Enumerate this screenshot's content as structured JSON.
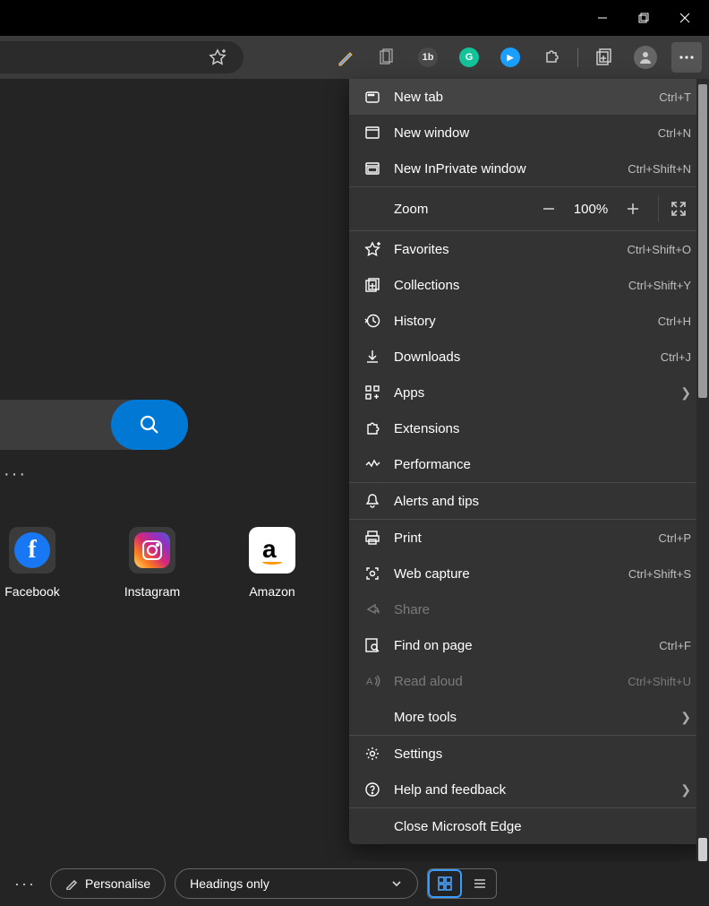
{
  "window": {
    "minimize": "Minimize",
    "restore": "Restore",
    "close": "Close"
  },
  "toolbar": {
    "favorite": "Add to favorites"
  },
  "tiles": [
    {
      "label": "Facebook",
      "bg": "#3b3b3b",
      "glyph_bg": "#1877f2",
      "glyph": "f",
      "glyph_color": "#fff"
    },
    {
      "label": "Instagram",
      "bg": "#3b3b3b",
      "glyph_bg": "linear-gradient(45deg,#feda75,#d62976,#4f5bd5)",
      "glyph": "ig",
      "glyph_color": "#fff"
    },
    {
      "label": "Amazon",
      "bg": "#ffffff",
      "glyph_bg": "#ffffff",
      "glyph": "a",
      "glyph_color": "#000"
    }
  ],
  "menu": {
    "zoom_label": "Zoom",
    "zoom_value": "100%",
    "items": [
      {
        "label": "New tab",
        "shortcut": "Ctrl+T",
        "icon": "newtab",
        "highlight": true
      },
      {
        "label": "New window",
        "shortcut": "Ctrl+N",
        "icon": "window"
      },
      {
        "label": "New InPrivate window",
        "shortcut": "Ctrl+Shift+N",
        "icon": "inprivate"
      },
      {
        "sep": true
      },
      {
        "zoom": true
      },
      {
        "sep": true
      },
      {
        "label": "Favorites",
        "shortcut": "Ctrl+Shift+O",
        "icon": "favorites"
      },
      {
        "label": "Collections",
        "shortcut": "Ctrl+Shift+Y",
        "icon": "collections"
      },
      {
        "label": "History",
        "shortcut": "Ctrl+H",
        "icon": "history"
      },
      {
        "label": "Downloads",
        "shortcut": "Ctrl+J",
        "icon": "downloads"
      },
      {
        "label": "Apps",
        "chevron": true,
        "icon": "apps"
      },
      {
        "label": "Extensions",
        "icon": "extensions"
      },
      {
        "label": "Performance",
        "icon": "performance"
      },
      {
        "sep": true
      },
      {
        "label": "Alerts and tips",
        "icon": "bell"
      },
      {
        "sep": true
      },
      {
        "label": "Print",
        "shortcut": "Ctrl+P",
        "icon": "print"
      },
      {
        "label": "Web capture",
        "shortcut": "Ctrl+Shift+S",
        "icon": "capture"
      },
      {
        "label": "Share",
        "icon": "share",
        "disabled": true
      },
      {
        "label": "Find on page",
        "shortcut": "Ctrl+F",
        "icon": "find"
      },
      {
        "label": "Read aloud",
        "shortcut": "Ctrl+Shift+U",
        "icon": "readaloud",
        "disabled": true
      },
      {
        "label": "More tools",
        "chevron": true,
        "icon": "blank"
      },
      {
        "sep": true
      },
      {
        "label": "Settings",
        "icon": "settings"
      },
      {
        "label": "Help and feedback",
        "chevron": true,
        "icon": "help"
      },
      {
        "sep": true
      },
      {
        "label": "Close Microsoft Edge",
        "icon": "blank"
      }
    ]
  },
  "bottombar": {
    "personalise": "Personalise",
    "headings": "Headings only"
  }
}
